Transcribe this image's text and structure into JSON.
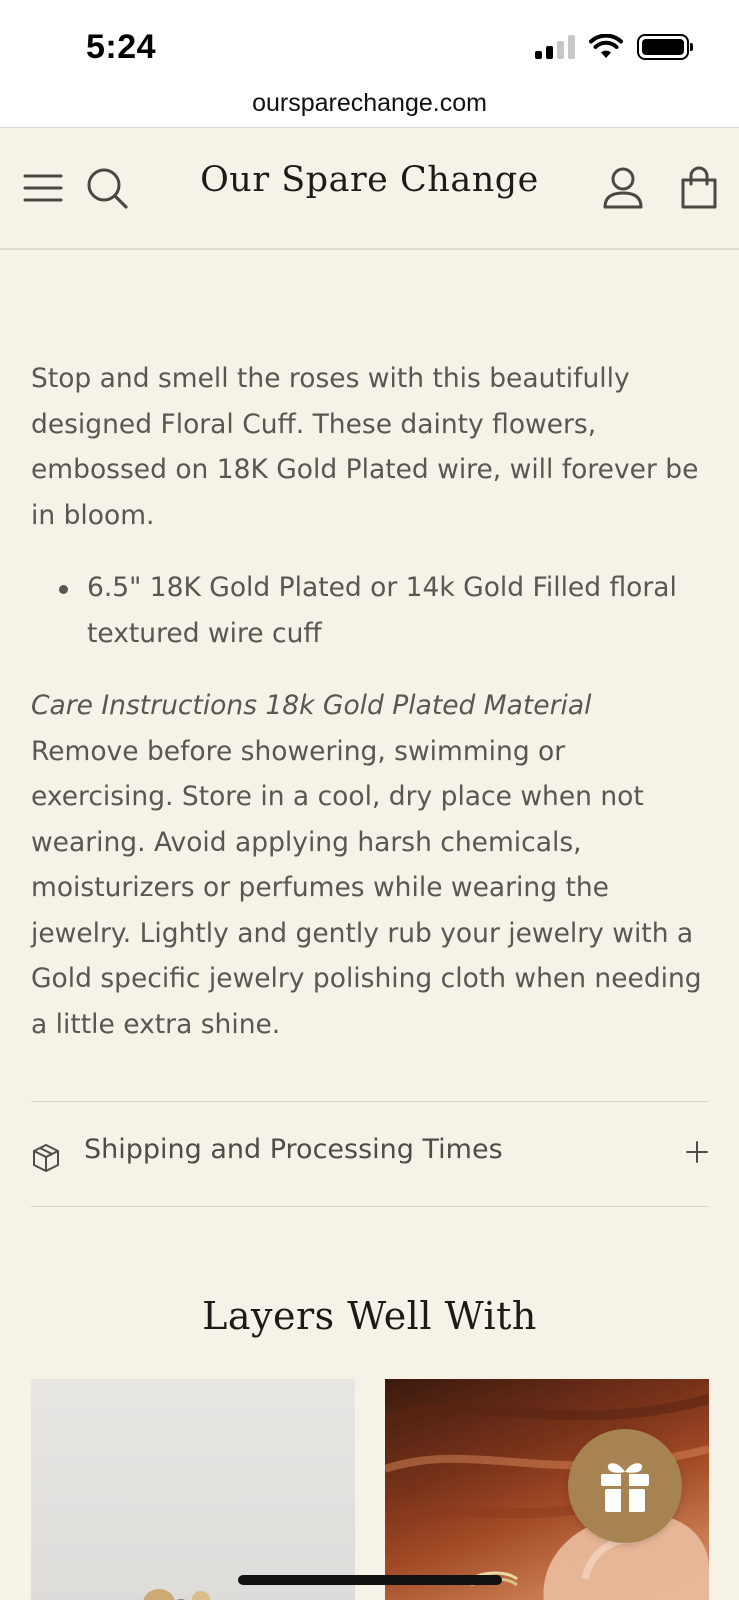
{
  "status_bar": {
    "time": "5:24",
    "icons": [
      "signal-icon",
      "wifi-icon",
      "battery-icon"
    ]
  },
  "browser": {
    "url": "oursparechange.com"
  },
  "header": {
    "site_title": "Our Spare Change",
    "icons": [
      "menu-icon",
      "search-icon",
      "account-icon",
      "cart-icon"
    ]
  },
  "description": {
    "intro": "Stop and smell the roses with this beautifully designed Floral Cuff. These dainty flowers, embossed on 18K Gold Plated wire, will forever be in bloom.",
    "bullets": [
      "6.5\" 18K Gold Plated or 14k Gold Filled floral textured wire cuff"
    ],
    "care_title": "Care Instructions 18k Gold Plated Material",
    "care_text": "Remove before showering, swimming or exercising. Store in a cool, dry place when not wearing. Avoid applying harsh chemicals, moisturizers or perfumes while wearing the jewelry. Lightly and gently rub your jewelry with a Gold specific jewelry polishing cloth when needing a little extra shine."
  },
  "accordion": {
    "label": "Shipping and Processing Times",
    "icon": "box-icon",
    "expand_icon": "plus-icon"
  },
  "related": {
    "title": "Layers Well With"
  },
  "colors": {
    "background": "#f6f2e7",
    "text": "#5a5651",
    "heading": "#1d1b18",
    "gift_button": "#a68350"
  }
}
